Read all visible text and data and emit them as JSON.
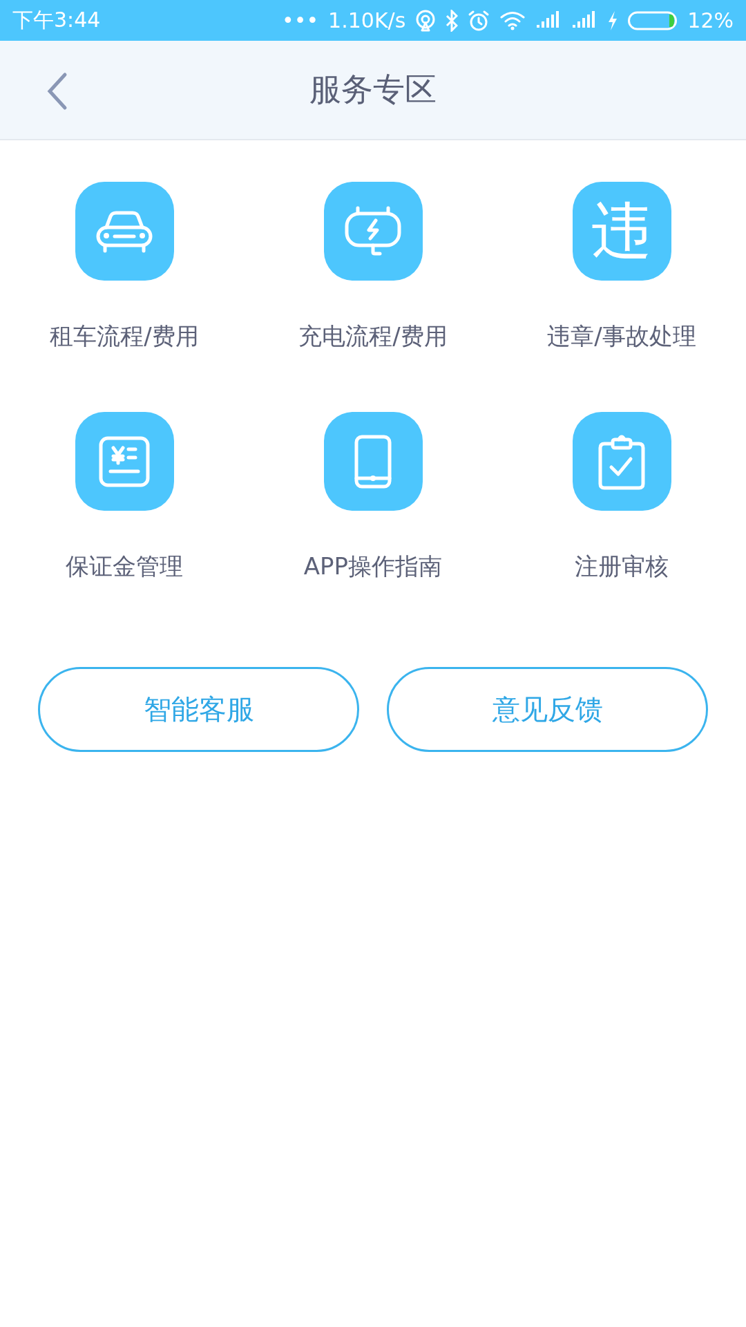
{
  "status_bar": {
    "time": "下午3:44",
    "dots": "•••",
    "speed": "1.10K/s",
    "battery": "12%"
  },
  "header": {
    "title": "服务专区"
  },
  "services": [
    {
      "label": "租车流程/费用",
      "kind": "car"
    },
    {
      "label": "充电流程/费用",
      "kind": "charger"
    },
    {
      "label": "违章/事故处理",
      "kind": "glyph",
      "glyph": "违"
    },
    {
      "label": "保证金管理",
      "kind": "receipt"
    },
    {
      "label": "APP操作指南",
      "kind": "tablet"
    },
    {
      "label": "注册审核",
      "kind": "clipboard"
    }
  ],
  "buttons": [
    "智能客服",
    "意见反馈"
  ]
}
